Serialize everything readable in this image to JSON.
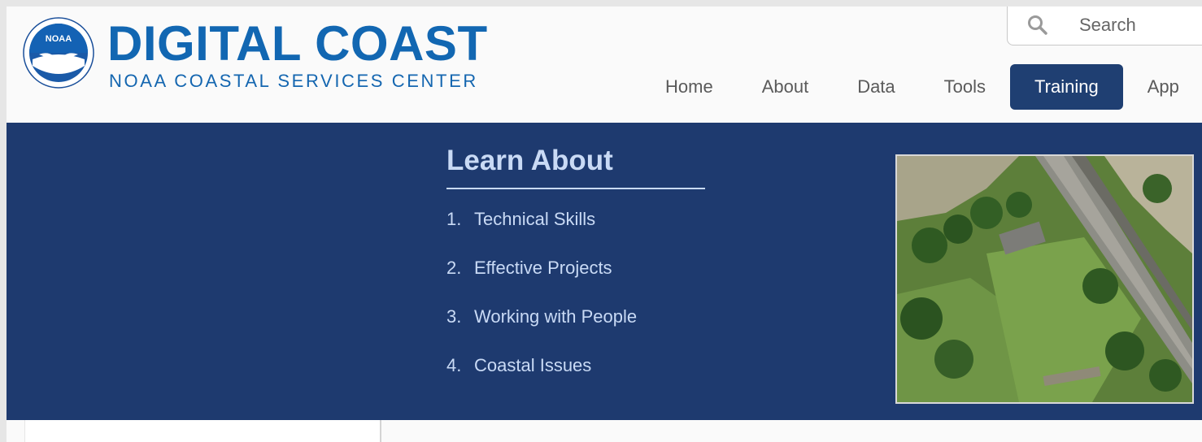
{
  "logo": {
    "title": "DIGITAL COAST",
    "subtitle": "NOAA COASTAL SERVICES CENTER",
    "seal_text": "NOAA"
  },
  "search": {
    "placeholder": "Search",
    "icon": "search-icon"
  },
  "nav": {
    "items": [
      {
        "label": "Home",
        "active": false
      },
      {
        "label": "About",
        "active": false
      },
      {
        "label": "Data",
        "active": false
      },
      {
        "label": "Tools",
        "active": false
      },
      {
        "label": "Training",
        "active": true
      },
      {
        "label": "Applications",
        "active": false
      }
    ],
    "visible_labels": [
      "Home",
      "About",
      "Data",
      "Tools",
      "Training",
      "App"
    ]
  },
  "learn_about": {
    "title": "Learn About",
    "items": [
      {
        "number": "1.",
        "label": "Technical Skills"
      },
      {
        "number": "2.",
        "label": "Effective Projects"
      },
      {
        "number": "3.",
        "label": "Working with People"
      },
      {
        "number": "4.",
        "label": "Coastal Issues"
      }
    ]
  },
  "colors": {
    "brand_blue": "#1267b2",
    "banner_navy": "#1e3a6f",
    "active_nav": "#1f3f72",
    "banner_text": "#c9daf5",
    "header_bg": "#fafafa"
  }
}
